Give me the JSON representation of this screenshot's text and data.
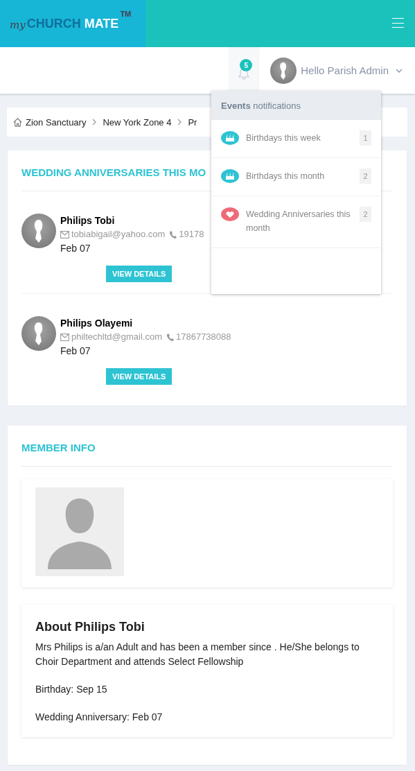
{
  "logo": {
    "prefix": "my",
    "part1": "CHURCH",
    "part2": "MATE",
    "mark": "TM"
  },
  "topbar": {
    "notification_count": "5",
    "greeting": "Hello Parish Admin"
  },
  "notifications": {
    "title": "**Events** notifications",
    "items": [
      {
        "kind": "birthday",
        "label": "Birthdays this week",
        "count": "1"
      },
      {
        "kind": "birthday",
        "label": "Birthdays this month",
        "count": "2"
      },
      {
        "kind": "anniversary",
        "label": "Wedding Anniversaries this month",
        "count": "2"
      }
    ]
  },
  "breadcrumb": [
    "Zion Sanctuary",
    "New York Zone 4",
    "Pr"
  ],
  "anniversaries": {
    "title": "WEDDING ANNIVERSARIES THIS MO",
    "members": [
      {
        "name": "Philips Tobi",
        "email": "tobiabigail@yahoo.com",
        "phone": "19178",
        "date": "Feb 07",
        "button": "VIEW DETAILS"
      },
      {
        "name": "Philips Olayemi",
        "email": "philtechltd@gmail.com",
        "phone": "17867738088",
        "date": "Feb 07",
        "button": "VIEW DETAILS"
      }
    ]
  },
  "member_info": {
    "title": "MEMBER INFO",
    "about_title": "About Philips Tobi",
    "paragraphs": [
      "Mrs Philips is a/an Adult and has been a member since . He/She belongs to Choir Department and attends Select Fellowship",
      "Birthday: Sep 15",
      "Wedding Anniversary: Feb 07"
    ]
  }
}
